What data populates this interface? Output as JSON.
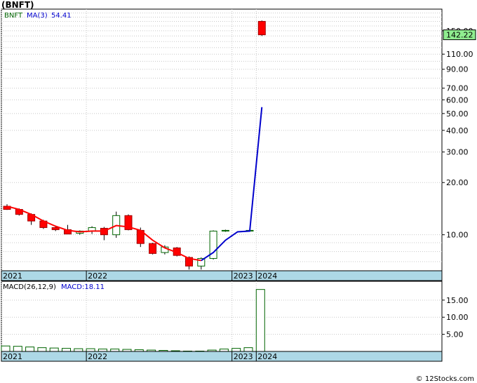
{
  "title": "(BNFT)",
  "footer": "© 12Stocks.com",
  "colors": {
    "up": "#ffffff",
    "down": "#ff0000",
    "ma_down": "#ff0000",
    "ma_up": "#0000cc",
    "macd_bar": "#006400",
    "axis_band": "#add8e6",
    "last_price_box": "#90ee90"
  },
  "chart_data": [
    {
      "type": "candlestick",
      "scale": "log",
      "legend": {
        "symbol": "BNFT",
        "ma_label": "MA(3)",
        "ma_value": "54.41"
      },
      "last_price": "142.22",
      "y_ticks": [
        "150.00",
        "110.00",
        "90.00",
        "70.00",
        "60.00",
        "50.00",
        "40.00",
        "30.00",
        "20.00",
        "10.00"
      ],
      "y_tick_values": [
        150,
        110,
        90,
        70,
        60,
        50,
        40,
        30,
        20,
        10
      ],
      "x_labels": [
        {
          "label": "2021",
          "index": 0
        },
        {
          "label": "2022",
          "index": 7
        },
        {
          "label": "2023",
          "index": 19
        },
        {
          "label": "2024",
          "index": 21
        }
      ],
      "ylim": [
        6.2,
        200
      ],
      "candles": [
        {
          "o": 14.6,
          "h": 15.0,
          "l": 13.9,
          "c": 14.0
        },
        {
          "o": 14.0,
          "h": 14.2,
          "l": 12.9,
          "c": 13.1
        },
        {
          "o": 13.1,
          "h": 13.3,
          "l": 11.4,
          "c": 12.0
        },
        {
          "o": 12.0,
          "h": 12.2,
          "l": 10.8,
          "c": 11.0
        },
        {
          "o": 11.0,
          "h": 11.3,
          "l": 10.5,
          "c": 10.7
        },
        {
          "o": 10.7,
          "h": 11.4,
          "l": 10.1,
          "c": 10.1
        },
        {
          "o": 10.2,
          "h": 10.6,
          "l": 10.0,
          "c": 10.5
        },
        {
          "o": 10.5,
          "h": 11.2,
          "l": 10.1,
          "c": 11.0
        },
        {
          "o": 10.9,
          "h": 11.1,
          "l": 9.3,
          "c": 10.0
        },
        {
          "o": 10.0,
          "h": 13.6,
          "l": 9.6,
          "c": 12.9
        },
        {
          "o": 12.9,
          "h": 13.1,
          "l": 10.6,
          "c": 10.7
        },
        {
          "o": 10.6,
          "h": 11.0,
          "l": 8.5,
          "c": 8.9
        },
        {
          "o": 8.9,
          "h": 9.0,
          "l": 7.7,
          "c": 7.8
        },
        {
          "o": 7.9,
          "h": 8.7,
          "l": 7.7,
          "c": 8.5
        },
        {
          "o": 8.4,
          "h": 8.5,
          "l": 7.5,
          "c": 7.6
        },
        {
          "o": 7.4,
          "h": 7.5,
          "l": 6.3,
          "c": 6.6
        },
        {
          "o": 6.6,
          "h": 7.4,
          "l": 6.3,
          "c": 7.3
        },
        {
          "o": 7.3,
          "h": 10.6,
          "l": 7.2,
          "c": 10.5
        },
        {
          "o": 10.5,
          "h": 10.7,
          "l": 10.4,
          "c": 10.6
        },
        null,
        {
          "o": 10.5,
          "h": 10.7,
          "l": 10.5,
          "c": 10.6
        },
        {
          "o": 170.0,
          "h": 172.0,
          "l": 140.0,
          "c": 142.22
        }
      ],
      "ma": [
        14.6,
        14.0,
        13.1,
        12.0,
        11.2,
        10.6,
        10.4,
        10.5,
        10.5,
        11.3,
        11.1,
        10.6,
        9.3,
        8.4,
        7.9,
        7.3,
        7.1,
        7.9,
        9.3,
        10.4,
        10.5,
        54.41
      ],
      "ma_down_until": 16
    },
    {
      "type": "bar",
      "legend": {
        "name": "MACD(26,12,9)",
        "value_label": "MACD:18.11"
      },
      "y_ticks": [
        "15.00",
        "10.00",
        "5.00"
      ],
      "y_tick_values": [
        15,
        10,
        5
      ],
      "ylim": [
        0,
        20.5
      ],
      "x_labels": [
        {
          "label": "2021",
          "index": 0
        },
        {
          "label": "2022",
          "index": 7
        },
        {
          "label": "2023",
          "index": 19
        },
        {
          "label": "2024",
          "index": 21
        }
      ],
      "values": [
        1.6,
        1.5,
        1.3,
        1.1,
        1.0,
        0.9,
        0.8,
        0.8,
        0.7,
        0.7,
        0.6,
        0.5,
        0.4,
        0.3,
        0.2,
        0.1,
        0.1,
        0.4,
        0.7,
        0.9,
        1.1,
        18.11
      ]
    }
  ]
}
